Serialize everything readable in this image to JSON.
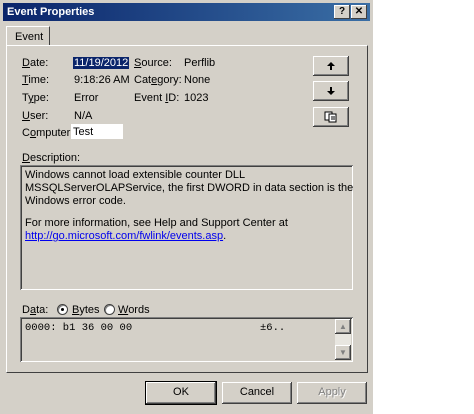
{
  "window": {
    "title": "Event Properties",
    "help_label": "?",
    "close_label": "✕"
  },
  "tabs": [
    {
      "label": "Event"
    }
  ],
  "fields": {
    "date_label": "Date:",
    "date_value": "11/19/2012",
    "time_label": "Time:",
    "time_value": "9:18:26 AM",
    "type_label": "Type:",
    "type_value": "Error",
    "user_label": "User:",
    "user_value": "N/A",
    "computer_label": "Computer:",
    "computer_value": "Test",
    "source_label": "Source:",
    "source_value": "Perflib",
    "category_label": "Category:",
    "category_value": "None",
    "event_id_label": "Event ID:",
    "event_id_value": "1023"
  },
  "nav_buttons": {
    "up_icon": "arrow-up",
    "down_icon": "arrow-down",
    "copy_icon": "copy"
  },
  "description": {
    "label": "Description:",
    "line1": "Windows cannot load extensible counter DLL",
    "line2": "MSSQLServerOLAPService, the first DWORD in data section is the",
    "line3": "Windows error code.",
    "line4": "For more information, see Help and Support Center at",
    "link": "http://go.microsoft.com/fwlink/events.asp",
    "link_suffix": "."
  },
  "data_section": {
    "label": "Data:",
    "bytes_label": "Bytes",
    "words_label": "Words",
    "selected": "Bytes",
    "hex_line": "0000: b1 36 00 00",
    "ascii_line": "±6.."
  },
  "footer": {
    "ok_label": "OK",
    "cancel_label": "Cancel",
    "apply_label": "Apply"
  }
}
